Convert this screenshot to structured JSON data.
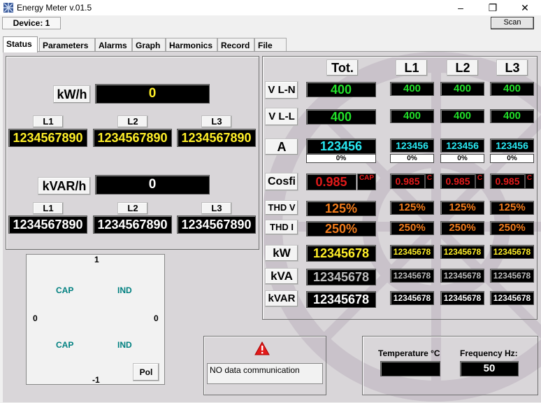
{
  "window": {
    "title": "Energy Meter v.01.5",
    "minimize": "–",
    "maximize": "❐",
    "close": "✕"
  },
  "toolbar": {
    "device_label": "Device: 1",
    "scan_label": "Scan"
  },
  "tabs": [
    "Status",
    "Parameters",
    "Alarms",
    "Graph",
    "Harmonics",
    "Record",
    "File"
  ],
  "energy": {
    "kwh_label": "kW/h",
    "kwh_total": "0",
    "kwh_phases": [
      {
        "label": "L1",
        "value": "1234567890"
      },
      {
        "label": "L2",
        "value": "1234567890"
      },
      {
        "label": "L3",
        "value": "1234567890"
      }
    ],
    "kvarh_label": "kVAR/h",
    "kvarh_total": "0",
    "kvarh_phases": [
      {
        "label": "L1",
        "value": "1234567890"
      },
      {
        "label": "L2",
        "value": "1234567890"
      },
      {
        "label": "L3",
        "value": "1234567890"
      }
    ]
  },
  "polar": {
    "top": "1",
    "bottom": "-1",
    "left": "0",
    "right": "0",
    "cap": "CAP",
    "ind": "IND",
    "pol_button": "Pol"
  },
  "grid": {
    "columns": [
      "Tot.",
      "L1",
      "L2",
      "L3"
    ],
    "rows": {
      "vln": {
        "label": "V L-N",
        "tot": "400",
        "l1": "400",
        "l2": "400",
        "l3": "400"
      },
      "vll": {
        "label": "V L-L",
        "tot": "400",
        "l1": "400",
        "l2": "400",
        "l3": "400"
      },
      "amp": {
        "label": "A",
        "tot": "123456",
        "l1": "123456",
        "l2": "123456",
        "l3": "123456",
        "pct_tot": "0%",
        "pct_l1": "0%",
        "pct_l2": "0%",
        "pct_l3": "0%"
      },
      "cos": {
        "label": "Cosfi",
        "tot": "0.985",
        "l1": "0.985",
        "l2": "0.985",
        "l3": "0.985",
        "tag_tot": "CAP",
        "tag_l1": "C",
        "tag_l2": "C",
        "tag_l3": "C"
      },
      "thdv": {
        "label": "THD V",
        "tot": "125%",
        "l1": "125%",
        "l2": "125%",
        "l3": "125%"
      },
      "thdi": {
        "label": "THD I",
        "tot": "250%",
        "l1": "250%",
        "l2": "250%",
        "l3": "250%"
      },
      "kw": {
        "label": "kW",
        "tot": "12345678",
        "l1": "12345678",
        "l2": "12345678",
        "l3": "12345678"
      },
      "kva": {
        "label": "kVA",
        "tot": "12345678",
        "l1": "12345678",
        "l2": "12345678",
        "l3": "12345678"
      },
      "kvar": {
        "label": "kVAR",
        "tot": "12345678",
        "l1": "12345678",
        "l2": "12345678",
        "l3": "12345678"
      }
    }
  },
  "status": {
    "message": "NO data communication",
    "icon": "warning-icon"
  },
  "env": {
    "temp_label": "Temperature °C",
    "temp_value": "",
    "freq_label": "Frequency Hz:",
    "freq_value": "50"
  },
  "colors": {
    "green": "#22e02a",
    "cyan": "#28e6f0",
    "red": "#e31a1a",
    "orange": "#f07a1a",
    "yellow": "#ffef28",
    "gray": "#bdbdbd",
    "white": "#ffffff",
    "teal": "#008080"
  }
}
